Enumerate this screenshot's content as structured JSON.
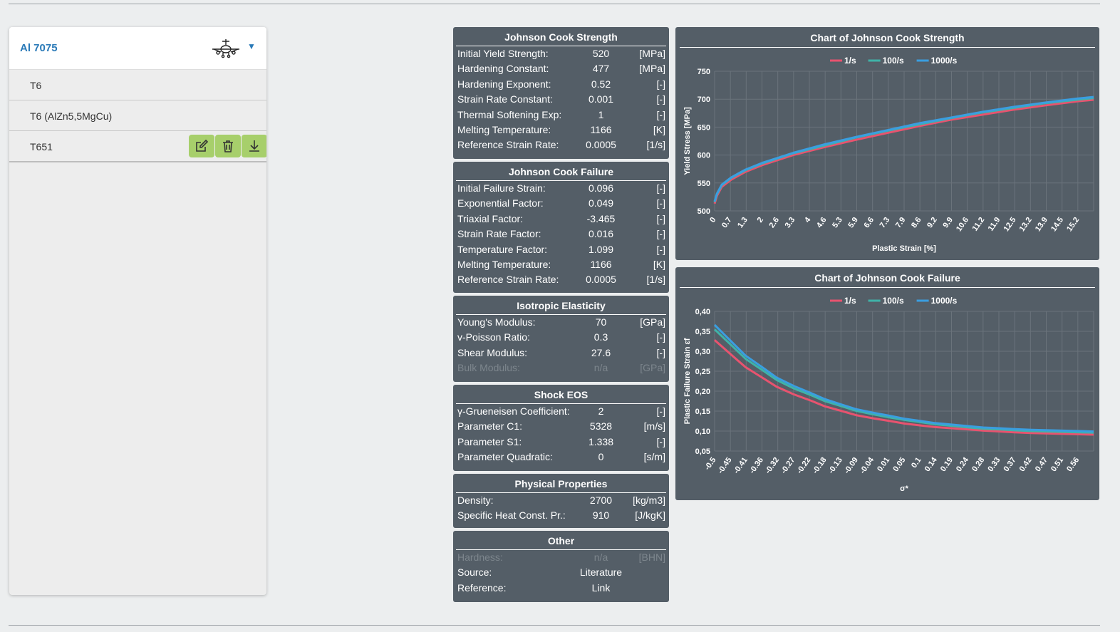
{
  "sidebar": {
    "title": "Al 7075",
    "icons": {
      "plane": "airplane-icon",
      "caret": "caret-down-icon"
    },
    "items": [
      {
        "label": "T6"
      },
      {
        "label": "T6 (AlZn5,5MgCu)"
      },
      {
        "label": "T651"
      }
    ],
    "actions": [
      "edit-icon",
      "trash-icon",
      "download-icon"
    ]
  },
  "tables": {
    "jc_strength": {
      "title": "Johnson Cook Strength",
      "rows": [
        {
          "k": "Initial Yield Strength:",
          "v": "520",
          "u": "[MPa]"
        },
        {
          "k": "Hardening Constant:",
          "v": "477",
          "u": "[MPa]"
        },
        {
          "k": "Hardening Exponent:",
          "v": "0.52",
          "u": "[-]"
        },
        {
          "k": "Strain Rate Constant:",
          "v": "0.001",
          "u": "[-]"
        },
        {
          "k": "Thermal Softening Exp:",
          "v": "1",
          "u": "[-]"
        },
        {
          "k": "Melting Temperature:",
          "v": "1166",
          "u": "[K]"
        },
        {
          "k": "Reference Strain Rate:",
          "v": "0.0005",
          "u": "[1/s]"
        }
      ]
    },
    "jc_failure": {
      "title": "Johnson Cook Failure",
      "rows": [
        {
          "k": "Initial Failure Strain:",
          "v": "0.096",
          "u": "[-]"
        },
        {
          "k": "Exponential Factor:",
          "v": "0.049",
          "u": "[-]"
        },
        {
          "k": "Triaxial Factor:",
          "v": "-3.465",
          "u": "[-]"
        },
        {
          "k": "Strain Rate Factor:",
          "v": "0.016",
          "u": "[-]"
        },
        {
          "k": "Temperature Factor:",
          "v": "1.099",
          "u": "[-]"
        },
        {
          "k": "Melting Temperature:",
          "v": "1166",
          "u": "[K]"
        },
        {
          "k": "Reference Strain Rate:",
          "v": "0.0005",
          "u": "[1/s]"
        }
      ]
    },
    "elasticity": {
      "title": "Isotropic Elasticity",
      "rows": [
        {
          "k": "Young's Modulus:",
          "v": "70",
          "u": "[GPa]"
        },
        {
          "k": "v-Poisson Ratio:",
          "v": "0.3",
          "u": "[-]"
        },
        {
          "k": "Shear Modulus:",
          "v": "27.6",
          "u": "[-]"
        },
        {
          "k": "Bulk Modulus:",
          "v": "n/a",
          "u": "[GPa]",
          "dim": true
        }
      ]
    },
    "shock": {
      "title": "Shock EOS",
      "rows": [
        {
          "k": "γ-Grueneisen Coefficient:",
          "v": "2",
          "u": "[-]"
        },
        {
          "k": "Parameter C1:",
          "v": "5328",
          "u": "[m/s]"
        },
        {
          "k": "Parameter S1:",
          "v": "1.338",
          "u": "[-]"
        },
        {
          "k": "Parameter Quadratic:",
          "v": "0",
          "u": "[s/m]"
        }
      ]
    },
    "physical": {
      "title": "Physical Properties",
      "rows": [
        {
          "k": "Density:",
          "v": "2700",
          "u": "[kg/m3]"
        },
        {
          "k": "Specific Heat Const. Pr.:",
          "v": "910",
          "u": "[J/kgK]"
        }
      ]
    },
    "other": {
      "title": "Other",
      "rows": [
        {
          "k": "Hardness:",
          "v": "n/a",
          "u": "[BHN]",
          "dim": true
        },
        {
          "k": "Source:",
          "v": "Literature",
          "u": ""
        },
        {
          "k": "Reference:",
          "v": "Link",
          "u": ""
        }
      ]
    }
  },
  "chart_data": [
    {
      "type": "line",
      "title": "Chart of Johnson Cook Strength",
      "xlabel": "Plastic Strain [%]",
      "ylabel": "Yield Stress [MPa]",
      "legend": "top",
      "grid": true,
      "xlim": [
        0,
        15.9
      ],
      "ylim": [
        500,
        750
      ],
      "yticks": [
        "500",
        "550",
        "600",
        "650",
        "700",
        "750"
      ],
      "xticks": [
        "0",
        "0.7",
        "1.3",
        "2",
        "2.6",
        "3.3",
        "4",
        "4.6",
        "5.3",
        "5.9",
        "6.6",
        "7.3",
        "7.9",
        "8.6",
        "9.2",
        "9.9",
        "10.6",
        "11.2",
        "11.9",
        "12.5",
        "13.2",
        "13.9",
        "14.5",
        "15.2"
      ],
      "series": [
        {
          "name": "1/s",
          "color": "#e8536f",
          "x": [
            0,
            0.1,
            0.3,
            0.7,
            1.3,
            2,
            3.3,
            4.6,
            5.9,
            7.3,
            8.6,
            9.9,
            11.2,
            12.5,
            13.9,
            15.2,
            15.9
          ],
          "y": [
            513,
            527,
            543,
            556,
            570,
            582,
            600,
            614,
            627,
            640,
            652,
            663,
            672,
            681,
            689,
            696,
            699
          ]
        },
        {
          "name": "100/s",
          "color": "#3fb3a8",
          "x": [
            0,
            0.1,
            0.3,
            0.7,
            1.3,
            2,
            3.3,
            4.6,
            5.9,
            7.3,
            8.6,
            9.9,
            11.2,
            12.5,
            13.9,
            15.2,
            15.9
          ],
          "y": [
            516,
            530,
            546,
            559,
            573,
            585,
            603,
            617,
            631,
            644,
            655,
            666,
            676,
            684,
            693,
            699,
            702
          ]
        },
        {
          "name": "1000/s",
          "color": "#3a9ee0",
          "x": [
            0,
            0.1,
            0.3,
            0.7,
            1.3,
            2,
            3.3,
            4.6,
            5.9,
            7.3,
            8.6,
            9.9,
            11.2,
            12.5,
            13.9,
            15.2,
            15.9
          ],
          "y": [
            517,
            531,
            547,
            560,
            574,
            586,
            604,
            619,
            632,
            645,
            657,
            667,
            677,
            686,
            694,
            701,
            704
          ]
        }
      ]
    },
    {
      "type": "line",
      "title": "Chart of Johnson Cook Failure",
      "xlabel": "σ*",
      "ylabel": "Plastic Failure Strain εf",
      "legend": "top",
      "grid": true,
      "xlim": [
        -0.5,
        0.6
      ],
      "ylim": [
        0.05,
        0.4
      ],
      "yticks": [
        "0,05",
        "0,10",
        "0,15",
        "0,20",
        "0,25",
        "0,30",
        "0,35",
        "0,40"
      ],
      "xticks": [
        "-0.5",
        "-0.45",
        "-0.41",
        "-0.36",
        "-0.32",
        "-0.27",
        "-0.22",
        "-0.18",
        "-0.13",
        "-0.09",
        "-0.04",
        "0.01",
        "0.05",
        "0.1",
        "0.14",
        "0.19",
        "0.24",
        "0.28",
        "0.33",
        "0.37",
        "0.42",
        "0.47",
        "0.51",
        "0.56"
      ],
      "series": [
        {
          "name": "1/s",
          "color": "#e8536f",
          "x": [
            -0.5,
            -0.45,
            -0.41,
            -0.36,
            -0.32,
            -0.27,
            -0.22,
            -0.18,
            -0.13,
            -0.09,
            -0.04,
            0.01,
            0.05,
            0.1,
            0.14,
            0.19,
            0.24,
            0.28,
            0.33,
            0.37,
            0.42,
            0.47,
            0.51,
            0.56,
            0.6
          ],
          "y": [
            0.328,
            0.29,
            0.26,
            0.233,
            0.211,
            0.192,
            0.176,
            0.162,
            0.15,
            0.14,
            0.132,
            0.125,
            0.119,
            0.114,
            0.11,
            0.107,
            0.104,
            0.101,
            0.099,
            0.097,
            0.095,
            0.094,
            0.093,
            0.092,
            0.091
          ]
        },
        {
          "name": "100/s",
          "color": "#3fb3a8",
          "x": [
            -0.5,
            -0.45,
            -0.41,
            -0.36,
            -0.32,
            -0.27,
            -0.22,
            -0.18,
            -0.13,
            -0.09,
            -0.04,
            0.01,
            0.05,
            0.1,
            0.14,
            0.19,
            0.24,
            0.28,
            0.33,
            0.37,
            0.42,
            0.47,
            0.51,
            0.56,
            0.6
          ],
          "y": [
            0.355,
            0.314,
            0.281,
            0.252,
            0.228,
            0.207,
            0.19,
            0.175,
            0.162,
            0.151,
            0.142,
            0.134,
            0.128,
            0.122,
            0.117,
            0.113,
            0.109,
            0.106,
            0.104,
            0.102,
            0.1,
            0.099,
            0.098,
            0.097,
            0.096
          ]
        },
        {
          "name": "1000/s",
          "color": "#3a9ee0",
          "x": [
            -0.5,
            -0.45,
            -0.41,
            -0.36,
            -0.32,
            -0.27,
            -0.22,
            -0.18,
            -0.13,
            -0.09,
            -0.04,
            0.01,
            0.05,
            0.1,
            0.14,
            0.19,
            0.24,
            0.28,
            0.33,
            0.37,
            0.42,
            0.47,
            0.51,
            0.56,
            0.6
          ],
          "y": [
            0.366,
            0.323,
            0.289,
            0.259,
            0.234,
            0.213,
            0.195,
            0.18,
            0.166,
            0.155,
            0.146,
            0.138,
            0.131,
            0.125,
            0.12,
            0.116,
            0.112,
            0.109,
            0.107,
            0.105,
            0.103,
            0.102,
            0.101,
            0.1,
            0.099
          ]
        }
      ]
    }
  ]
}
